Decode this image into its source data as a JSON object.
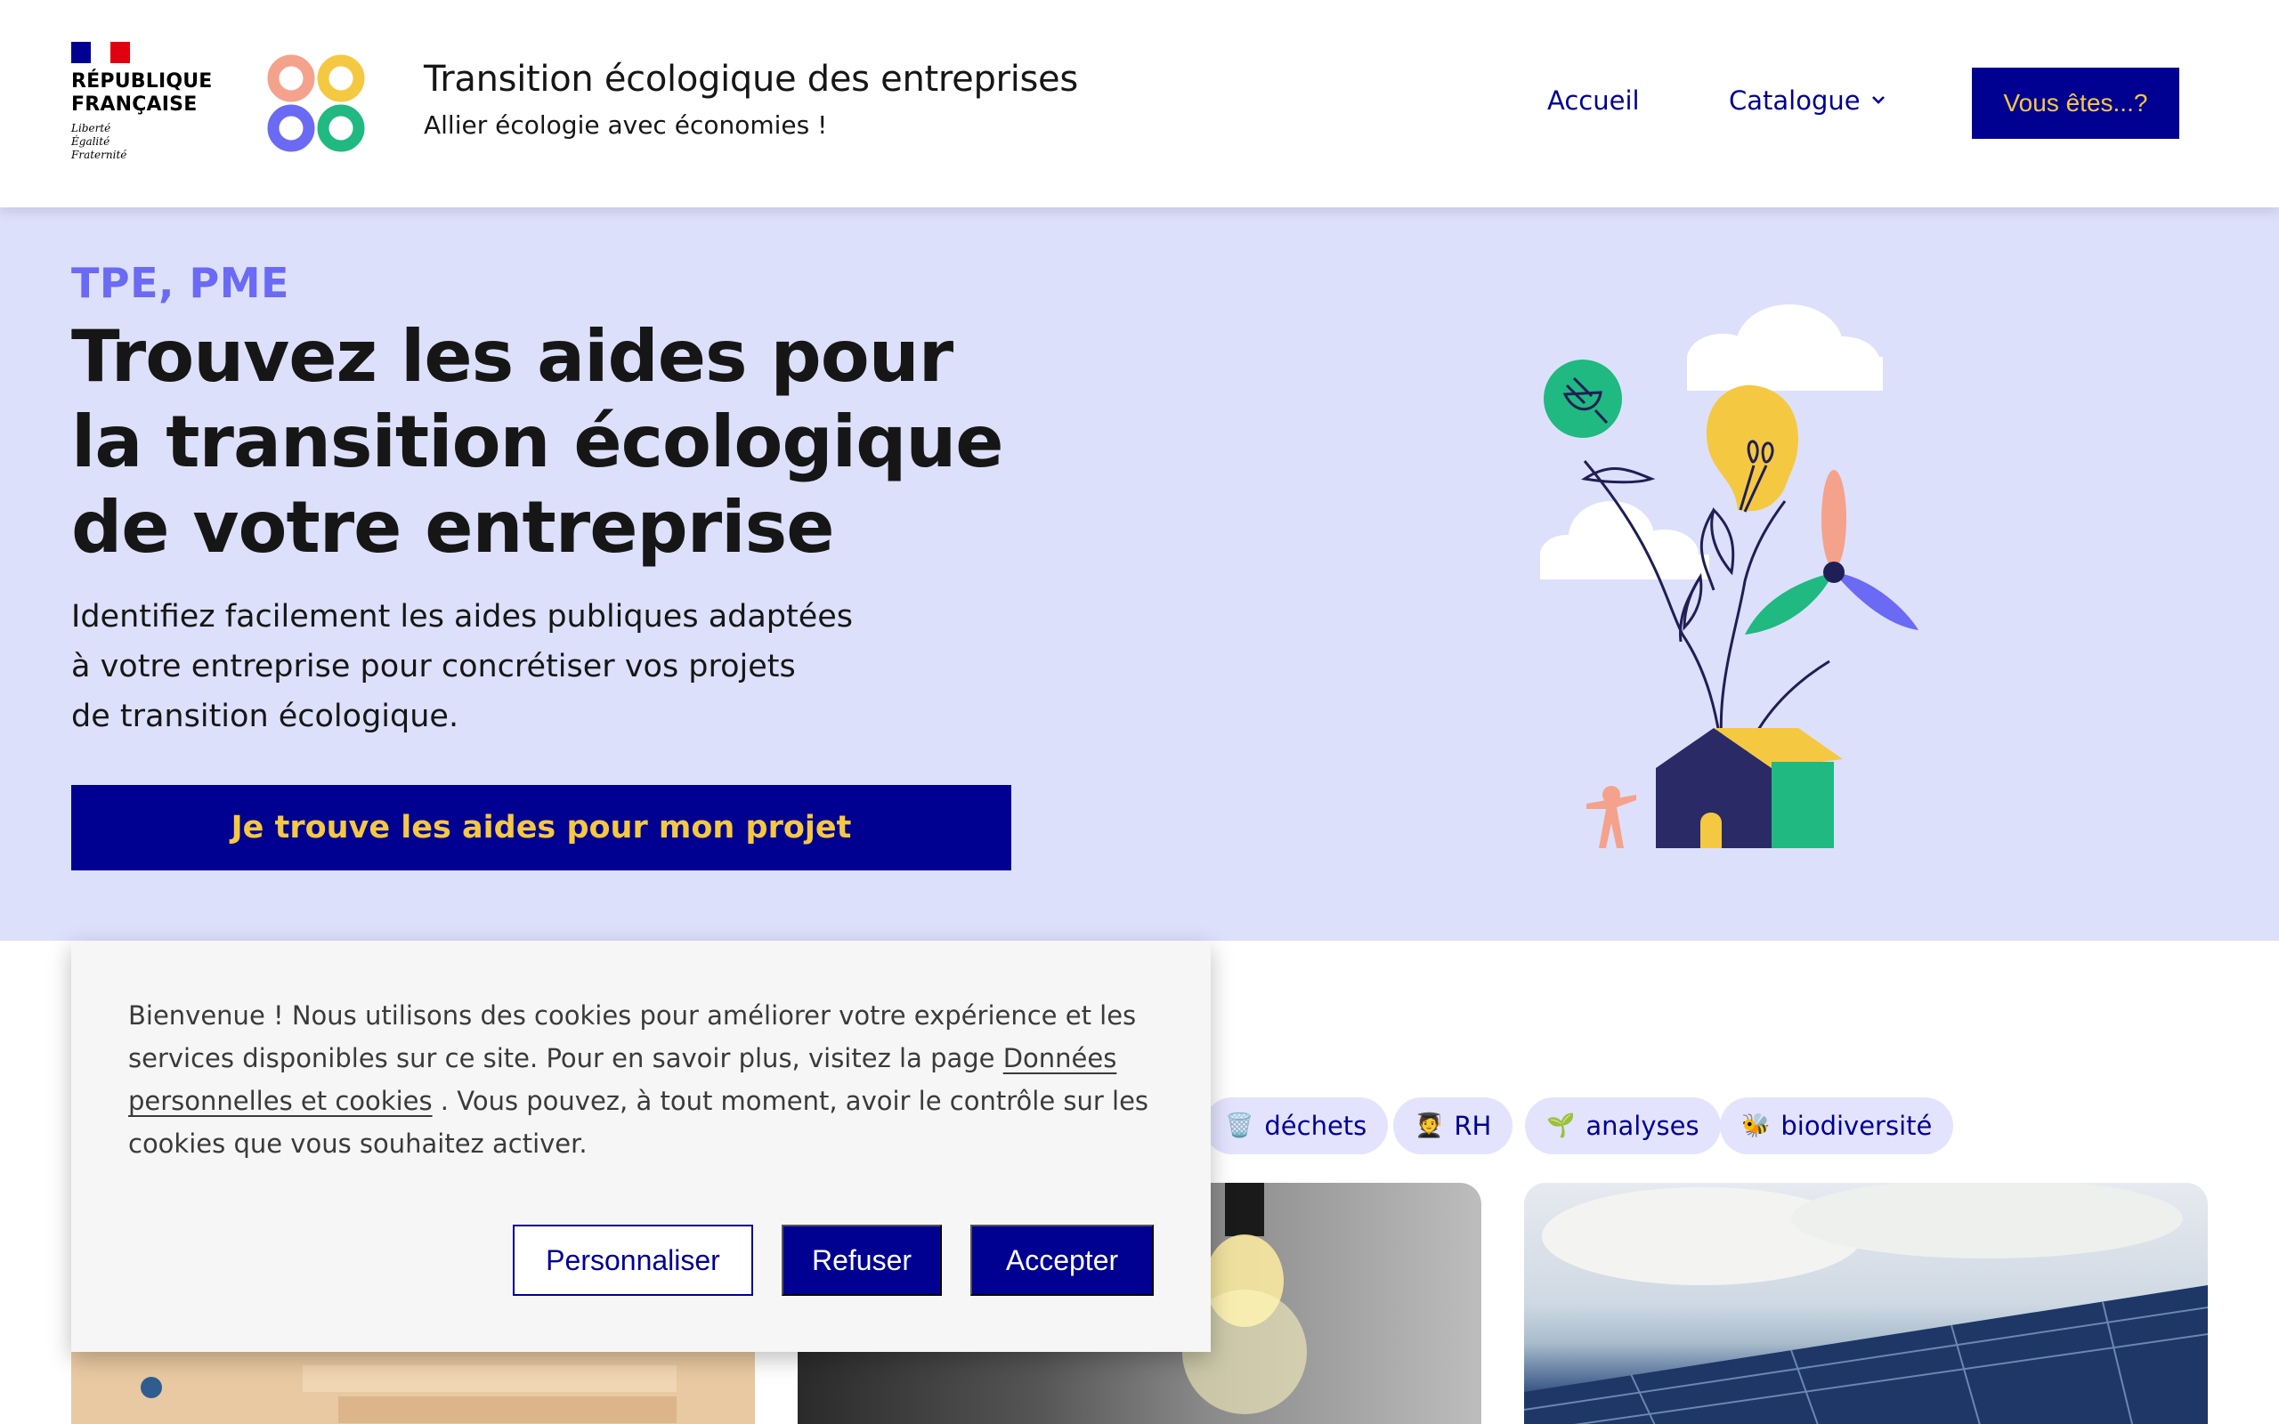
{
  "header": {
    "gov_name_line1": "RÉPUBLIQUE",
    "gov_name_line2": "FRANÇAISE",
    "gov_motto_1": "Liberté",
    "gov_motto_2": "Égalité",
    "gov_motto_3": "Fraternité",
    "site_title": "Transition écologique des entreprises",
    "site_tagline": "Allier écologie avec économies !",
    "nav": {
      "accueil": "Accueil",
      "catalogue": "Catalogue",
      "vous_etes": "Vous êtes...?"
    }
  },
  "hero": {
    "kicker": "TPE, PME",
    "title_lines": [
      "Trouvez les aides pour",
      "la transition écologique",
      "de votre entreprise"
    ],
    "desc_lines": [
      "Identifiez facilement les aides publiques adaptées",
      "à votre entreprise pour concrétiser vos projets",
      "de transition écologique."
    ],
    "cta": "Je trouve les aides pour mon projet"
  },
  "tags": [
    {
      "emoji": "🗑️",
      "label": "déchets"
    },
    {
      "emoji": "🧑‍🎓",
      "label": "RH"
    },
    {
      "emoji": "🌱",
      "label": "analyses"
    },
    {
      "emoji": "🐝",
      "label": "biodiversité"
    }
  ],
  "cookie": {
    "line1": "Bienvenue ! Nous utilisons des cookies pour améliorer votre expérience et les",
    "line2_pre": "services disponibles sur ce site. Pour en savoir plus, visitez la page ",
    "link_part1": "Données",
    "link_part2": "personnelles et cookies",
    "line3_post": " . Vous pouvez, à tout moment, avoir le contrôle sur les",
    "line4": "cookies que vous souhaitez activer.",
    "btn_personnaliser": "Personnaliser",
    "btn_refuser": "Refuser",
    "btn_accepter": "Accepter"
  },
  "colors": {
    "primary": "#000091",
    "accent_yellow": "#f5c842",
    "hero_bg": "#dde0fb",
    "kicker": "#6a6af4",
    "tag_bg": "#e3e3fd"
  }
}
